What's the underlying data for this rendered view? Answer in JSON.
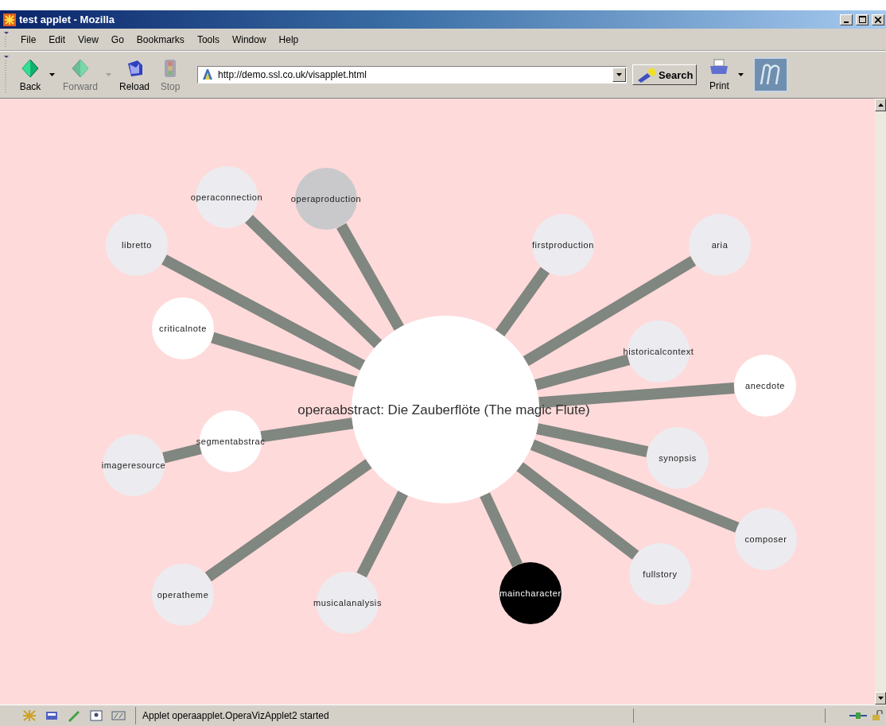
{
  "window": {
    "title": "test applet - Mozilla"
  },
  "menu": [
    "File",
    "Edit",
    "View",
    "Go",
    "Bookmarks",
    "Tools",
    "Window",
    "Help"
  ],
  "toolbar": [
    {
      "label": "Back",
      "kind": "back",
      "disabled": false,
      "dropdown": true
    },
    {
      "label": "Forward",
      "kind": "forward",
      "disabled": true,
      "dropdown": true
    },
    {
      "label": "Reload",
      "kind": "reload",
      "disabled": false,
      "dropdown": false
    },
    {
      "label": "Stop",
      "kind": "stop",
      "disabled": true,
      "dropdown": false
    }
  ],
  "address": {
    "value": "http://demo.ssl.co.uk/visapplet.html"
  },
  "search_button": "Search",
  "print_button": "Print",
  "graph": {
    "center": {
      "label": "operaabstract: Die Zauberflöte (The magic Flute)",
      "color": "#ffffff"
    },
    "children": [
      {
        "label": "operaconnection",
        "color": "#ececf0"
      },
      {
        "label": "operaproduction",
        "color": "#c9c9cb"
      },
      {
        "label": "libretto",
        "color": "#ececf0"
      },
      {
        "label": "firstproduction",
        "color": "#ececf0"
      },
      {
        "label": "aria",
        "color": "#ececf0"
      },
      {
        "label": "criticalnote",
        "color": "#ffffff"
      },
      {
        "label": "historicalcontext",
        "color": "#ececf0"
      },
      {
        "label": "anecdote",
        "color": "#ffffff"
      },
      {
        "label": "segmentabstrac",
        "color": "#ffffff",
        "children": [
          {
            "label": "imageresource",
            "color": "#ececf0"
          }
        ]
      },
      {
        "label": "synopsis",
        "color": "#ececf0"
      },
      {
        "label": "composer",
        "color": "#ececf0"
      },
      {
        "label": "operatheme",
        "color": "#ececf0"
      },
      {
        "label": "fullstory",
        "color": "#ececf0"
      },
      {
        "label": "musicalanalysis",
        "color": "#ececf0"
      },
      {
        "label": "maincharacter",
        "color": "#000000"
      }
    ]
  },
  "status_bar": {
    "message": "Applet operaapplet.OperaVizApplet2 started"
  }
}
